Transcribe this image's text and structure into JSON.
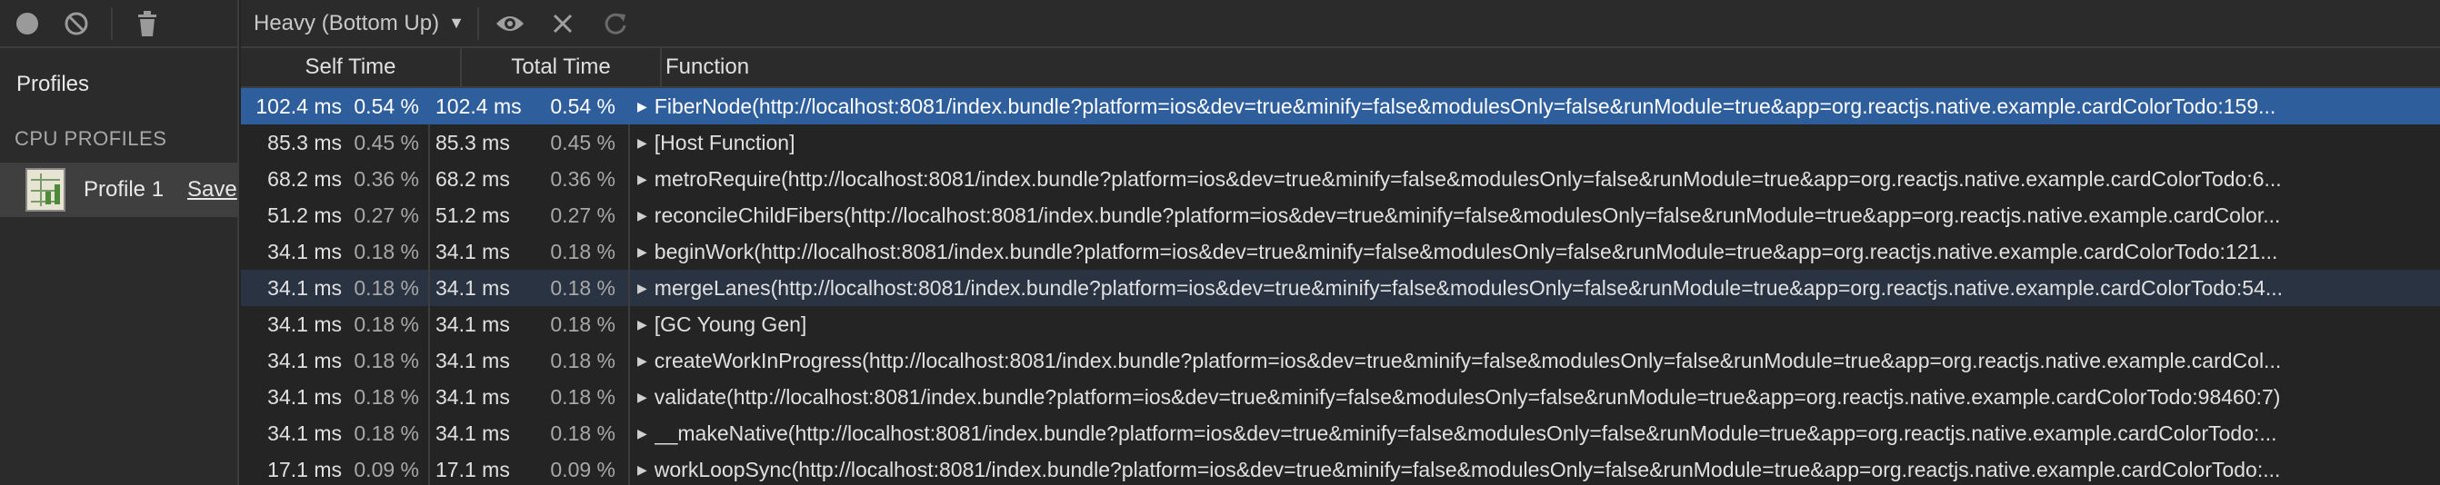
{
  "sidebar": {
    "profiles_label": "Profiles",
    "section_label": "CPU PROFILES",
    "profile": {
      "name": "Profile 1",
      "save_label": "Save"
    }
  },
  "toolbar": {
    "view_select": "Heavy (Bottom Up)",
    "icons": [
      "record-icon",
      "clear-icon",
      "trash-icon",
      "eye-icon",
      "close-icon",
      "reload-icon"
    ]
  },
  "table": {
    "headers": {
      "self_time": "Self Time",
      "total_time": "Total Time",
      "function": "Function"
    },
    "rows": [
      {
        "self_ms": "102.4 ms",
        "self_pct": "0.54 %",
        "total_ms": "102.4 ms",
        "total_pct": "0.54 %",
        "function": "FiberNode(http://localhost:8081/index.bundle?platform=ios&dev=true&minify=false&modulesOnly=false&runModule=true&app=org.reactjs.native.example.cardColorTodo:159..."
      },
      {
        "self_ms": "85.3 ms",
        "self_pct": "0.45 %",
        "total_ms": "85.3 ms",
        "total_pct": "0.45 %",
        "function": "[Host Function]"
      },
      {
        "self_ms": "68.2 ms",
        "self_pct": "0.36 %",
        "total_ms": "68.2 ms",
        "total_pct": "0.36 %",
        "function": "metroRequire(http://localhost:8081/index.bundle?platform=ios&dev=true&minify=false&modulesOnly=false&runModule=true&app=org.reactjs.native.example.cardColorTodo:6..."
      },
      {
        "self_ms": "51.2 ms",
        "self_pct": "0.27 %",
        "total_ms": "51.2 ms",
        "total_pct": "0.27 %",
        "function": "reconcileChildFibers(http://localhost:8081/index.bundle?platform=ios&dev=true&minify=false&modulesOnly=false&runModule=true&app=org.reactjs.native.example.cardColor..."
      },
      {
        "self_ms": "34.1 ms",
        "self_pct": "0.18 %",
        "total_ms": "34.1 ms",
        "total_pct": "0.18 %",
        "function": "beginWork(http://localhost:8081/index.bundle?platform=ios&dev=true&minify=false&modulesOnly=false&runModule=true&app=org.reactjs.native.example.cardColorTodo:121..."
      },
      {
        "self_ms": "34.1 ms",
        "self_pct": "0.18 %",
        "total_ms": "34.1 ms",
        "total_pct": "0.18 %",
        "function": "mergeLanes(http://localhost:8081/index.bundle?platform=ios&dev=true&minify=false&modulesOnly=false&runModule=true&app=org.reactjs.native.example.cardColorTodo:54..."
      },
      {
        "self_ms": "34.1 ms",
        "self_pct": "0.18 %",
        "total_ms": "34.1 ms",
        "total_pct": "0.18 %",
        "function": "[GC Young Gen]"
      },
      {
        "self_ms": "34.1 ms",
        "self_pct": "0.18 %",
        "total_ms": "34.1 ms",
        "total_pct": "0.18 %",
        "function": "createWorkInProgress(http://localhost:8081/index.bundle?platform=ios&dev=true&minify=false&modulesOnly=false&runModule=true&app=org.reactjs.native.example.cardCol..."
      },
      {
        "self_ms": "34.1 ms",
        "self_pct": "0.18 %",
        "total_ms": "34.1 ms",
        "total_pct": "0.18 %",
        "function": "validate(http://localhost:8081/index.bundle?platform=ios&dev=true&minify=false&modulesOnly=false&runModule=true&app=org.reactjs.native.example.cardColorTodo:98460:7)"
      },
      {
        "self_ms": "34.1 ms",
        "self_pct": "0.18 %",
        "total_ms": "34.1 ms",
        "total_pct": "0.18 %",
        "function": "__makeNative(http://localhost:8081/index.bundle?platform=ios&dev=true&minify=false&modulesOnly=false&runModule=true&app=org.reactjs.native.example.cardColorTodo:..."
      },
      {
        "self_ms": "17.1 ms",
        "self_pct": "0.09 %",
        "total_ms": "17.1 ms",
        "total_pct": "0.09 %",
        "function": "workLoopSync(http://localhost:8081/index.bundle?platform=ios&dev=true&minify=false&modulesOnly=false&runModule=true&app=org.reactjs.native.example.cardColorTodo:..."
      }
    ]
  },
  "colors": {
    "selected_row": "#2e5f9c",
    "background": "#242424",
    "sidebar": "#2b2b2b"
  }
}
